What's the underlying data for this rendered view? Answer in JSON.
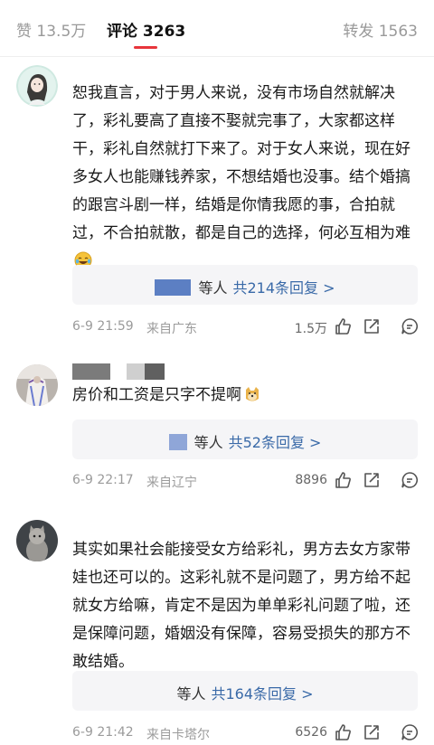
{
  "tabs": {
    "likes": "赞 13.5万",
    "comments": "评论 3263",
    "reposts": "转发 1563"
  },
  "comments": [
    {
      "text": "恕我直言，对于男人来说，没有市场自然就解决了，彩礼要高了直接不娶就完事了，大家都这样干，彩礼自然就打下来了。对于女人来说，现在好多女人也能赚钱养家，不想结婚也没事。结个婚搞的跟宫斗剧一样，结婚是你情我愿的事，合拍就过，不合拍就散，都是自己的选择，何必互相为难",
      "emoji": "laughing-crying-emoji",
      "reply_prefix": "等人",
      "reply_link": "共214条回复 >",
      "date": "6-9 21:59",
      "location": "来自广东",
      "like_count": "1.5万"
    },
    {
      "text": "房价和工资是只字不提啊",
      "emoji": "doge-emoji",
      "reply_prefix": "等人",
      "reply_link": "共52条回复 >",
      "date": "6-9 22:17",
      "location": "来自辽宁",
      "like_count": "8896"
    },
    {
      "text": "其实如果社会能接受女方给彩礼，男方去女方家带娃也还可以的。这彩礼就不是问题了，男方给不起就女方给嘛，肯定不是因为单单彩礼问题了啦，还是保障问题，婚姻没有保障，容易受损失的那方不敢结婚。",
      "reply_prefix": "等人",
      "reply_link": "共164条回复 >",
      "date": "6-9 21:42",
      "location": "来自卡塔尔",
      "like_count": "6526"
    }
  ],
  "colors": {
    "accent": "#e8353b",
    "link": "#3a6aa8",
    "meta": "#9b9b9b",
    "reply_bg": "#f5f5f7"
  },
  "icons": [
    "thumbs-up-icon",
    "share-icon",
    "comment-icon"
  ]
}
